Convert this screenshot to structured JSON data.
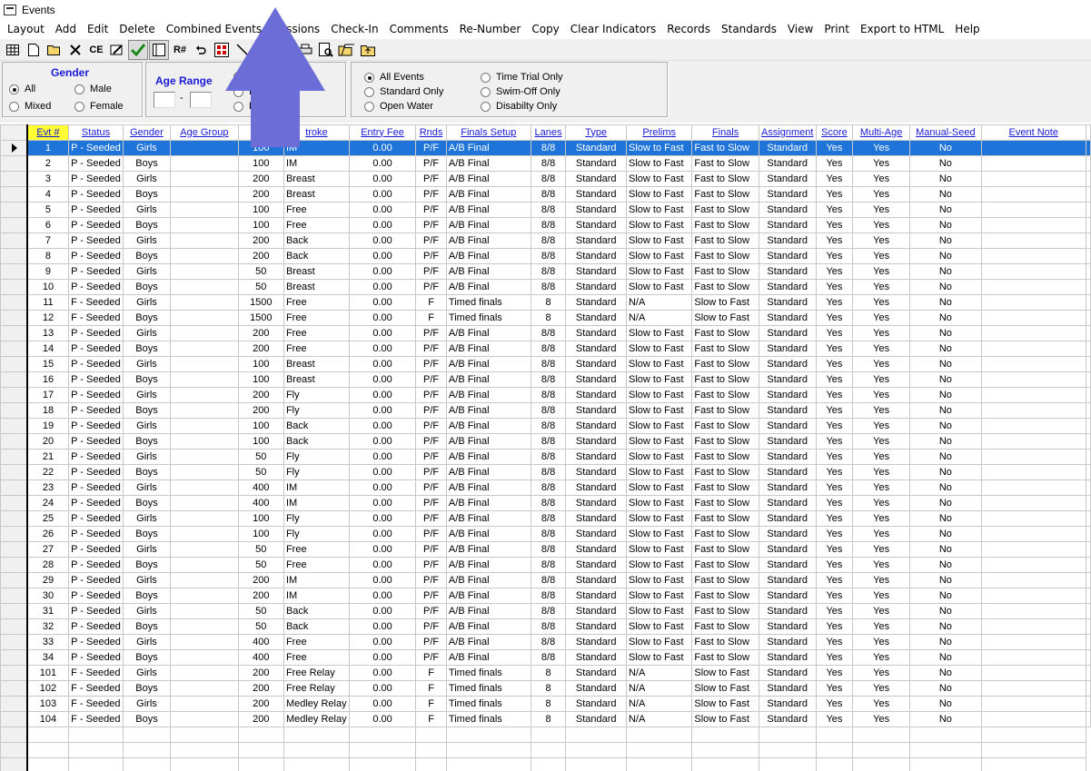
{
  "window": {
    "title": "Events"
  },
  "menu": [
    "Layout",
    "Add",
    "Edit",
    "Delete",
    "Combined Events",
    "Sessions",
    "Check-In",
    "Comments",
    "Re-Number",
    "Copy",
    "Clear Indicators",
    "Records",
    "Standards",
    "View",
    "Print",
    "Export to HTML",
    "Help"
  ],
  "toolbar": {
    "buttons": [
      {
        "name": "grid-icon"
      },
      {
        "name": "new-doc-icon"
      },
      {
        "name": "open-folder-icon"
      },
      {
        "name": "delete-x-icon"
      },
      {
        "name": "ce-icon",
        "text": "CE"
      },
      {
        "name": "edit-icon"
      },
      {
        "name": "checkmark-icon",
        "pressed": true
      },
      {
        "name": "panel-icon",
        "pressed": true
      },
      {
        "name": "renumber-icon",
        "text": "R#"
      },
      {
        "name": "undo-icon"
      },
      {
        "name": "calc-icon"
      },
      {
        "name": "arrows-icon"
      },
      {
        "name": "hidden-1-icon"
      },
      {
        "name": "hidden-2-icon"
      },
      {
        "name": "printer-icon"
      },
      {
        "name": "preview-icon"
      },
      {
        "name": "folder-open-icon"
      },
      {
        "name": "folder-up-icon"
      }
    ]
  },
  "filters": {
    "gender": {
      "title": "Gender",
      "options": [
        "All",
        "Male",
        "Mixed",
        "Female"
      ],
      "selected": "All"
    },
    "age_range": {
      "title": "Age Range",
      "separator": "-"
    },
    "round": {
      "options": [
        "I",
        "R",
        "y"
      ]
    },
    "event_type": {
      "options": [
        "All Events",
        "Standard Only",
        "Open Water",
        "Time Trial Only",
        "Swim-Off Only",
        "Disabilty Only"
      ],
      "selected": "All Events"
    }
  },
  "grid": {
    "columns": [
      "Evt #",
      "Status",
      "Gender",
      "Age Group",
      "Dist",
      "Stroke",
      "Entry Fee",
      "Rnds",
      "Finals Setup",
      "Lanes",
      "Type",
      "Prelims",
      "Finals",
      "Assignment",
      "Score",
      "Multi-Age",
      "Manual-Seed",
      "Event Note"
    ],
    "column_display": [
      "Evt #",
      "Status",
      "Gender",
      "Age Group",
      "Di",
      "troke",
      "Entry Fee",
      "Rnds",
      "Finals Setup",
      "Lanes",
      "Type",
      "Prelims",
      "Finals",
      "Assignment",
      "Score",
      "Multi-Age",
      "Manual-Seed",
      "Event Note"
    ],
    "selected_row": 0,
    "rows": [
      [
        "1",
        "P - Seeded",
        "Girls",
        "",
        "100",
        "IM",
        "0.00",
        "P/F",
        "A/B Final",
        "8/8",
        "Standard",
        "Slow to Fast",
        "Fast to Slow",
        "Standard",
        "Yes",
        "Yes",
        "No",
        ""
      ],
      [
        "2",
        "P - Seeded",
        "Boys",
        "",
        "100",
        "IM",
        "0.00",
        "P/F",
        "A/B Final",
        "8/8",
        "Standard",
        "Slow to Fast",
        "Fast to Slow",
        "Standard",
        "Yes",
        "Yes",
        "No",
        ""
      ],
      [
        "3",
        "P - Seeded",
        "Girls",
        "",
        "200",
        "Breast",
        "0.00",
        "P/F",
        "A/B Final",
        "8/8",
        "Standard",
        "Slow to Fast",
        "Fast to Slow",
        "Standard",
        "Yes",
        "Yes",
        "No",
        ""
      ],
      [
        "4",
        "P - Seeded",
        "Boys",
        "",
        "200",
        "Breast",
        "0.00",
        "P/F",
        "A/B Final",
        "8/8",
        "Standard",
        "Slow to Fast",
        "Fast to Slow",
        "Standard",
        "Yes",
        "Yes",
        "No",
        ""
      ],
      [
        "5",
        "P - Seeded",
        "Girls",
        "",
        "100",
        "Free",
        "0.00",
        "P/F",
        "A/B Final",
        "8/8",
        "Standard",
        "Slow to Fast",
        "Fast to Slow",
        "Standard",
        "Yes",
        "Yes",
        "No",
        ""
      ],
      [
        "6",
        "P - Seeded",
        "Boys",
        "",
        "100",
        "Free",
        "0.00",
        "P/F",
        "A/B Final",
        "8/8",
        "Standard",
        "Slow to Fast",
        "Fast to Slow",
        "Standard",
        "Yes",
        "Yes",
        "No",
        ""
      ],
      [
        "7",
        "P - Seeded",
        "Girls",
        "",
        "200",
        "Back",
        "0.00",
        "P/F",
        "A/B Final",
        "8/8",
        "Standard",
        "Slow to Fast",
        "Fast to Slow",
        "Standard",
        "Yes",
        "Yes",
        "No",
        ""
      ],
      [
        "8",
        "P - Seeded",
        "Boys",
        "",
        "200",
        "Back",
        "0.00",
        "P/F",
        "A/B Final",
        "8/8",
        "Standard",
        "Slow to Fast",
        "Fast to Slow",
        "Standard",
        "Yes",
        "Yes",
        "No",
        ""
      ],
      [
        "9",
        "P - Seeded",
        "Girls",
        "",
        "50",
        "Breast",
        "0.00",
        "P/F",
        "A/B Final",
        "8/8",
        "Standard",
        "Slow to Fast",
        "Fast to Slow",
        "Standard",
        "Yes",
        "Yes",
        "No",
        ""
      ],
      [
        "10",
        "P - Seeded",
        "Boys",
        "",
        "50",
        "Breast",
        "0.00",
        "P/F",
        "A/B Final",
        "8/8",
        "Standard",
        "Slow to Fast",
        "Fast to Slow",
        "Standard",
        "Yes",
        "Yes",
        "No",
        ""
      ],
      [
        "11",
        "F - Seeded",
        "Girls",
        "",
        "1500",
        "Free",
        "0.00",
        "F",
        "Timed finals",
        "8",
        "Standard",
        "N/A",
        "Slow to Fast",
        "Standard",
        "Yes",
        "Yes",
        "No",
        ""
      ],
      [
        "12",
        "F - Seeded",
        "Boys",
        "",
        "1500",
        "Free",
        "0.00",
        "F",
        "Timed finals",
        "8",
        "Standard",
        "N/A",
        "Slow to Fast",
        "Standard",
        "Yes",
        "Yes",
        "No",
        ""
      ],
      [
        "13",
        "P - Seeded",
        "Girls",
        "",
        "200",
        "Free",
        "0.00",
        "P/F",
        "A/B Final",
        "8/8",
        "Standard",
        "Slow to Fast",
        "Fast to Slow",
        "Standard",
        "Yes",
        "Yes",
        "No",
        ""
      ],
      [
        "14",
        "P - Seeded",
        "Boys",
        "",
        "200",
        "Free",
        "0.00",
        "P/F",
        "A/B Final",
        "8/8",
        "Standard",
        "Slow to Fast",
        "Fast to Slow",
        "Standard",
        "Yes",
        "Yes",
        "No",
        ""
      ],
      [
        "15",
        "P - Seeded",
        "Girls",
        "",
        "100",
        "Breast",
        "0.00",
        "P/F",
        "A/B Final",
        "8/8",
        "Standard",
        "Slow to Fast",
        "Fast to Slow",
        "Standard",
        "Yes",
        "Yes",
        "No",
        ""
      ],
      [
        "16",
        "P - Seeded",
        "Boys",
        "",
        "100",
        "Breast",
        "0.00",
        "P/F",
        "A/B Final",
        "8/8",
        "Standard",
        "Slow to Fast",
        "Fast to Slow",
        "Standard",
        "Yes",
        "Yes",
        "No",
        ""
      ],
      [
        "17",
        "P - Seeded",
        "Girls",
        "",
        "200",
        "Fly",
        "0.00",
        "P/F",
        "A/B Final",
        "8/8",
        "Standard",
        "Slow to Fast",
        "Fast to Slow",
        "Standard",
        "Yes",
        "Yes",
        "No",
        ""
      ],
      [
        "18",
        "P - Seeded",
        "Boys",
        "",
        "200",
        "Fly",
        "0.00",
        "P/F",
        "A/B Final",
        "8/8",
        "Standard",
        "Slow to Fast",
        "Fast to Slow",
        "Standard",
        "Yes",
        "Yes",
        "No",
        ""
      ],
      [
        "19",
        "P - Seeded",
        "Girls",
        "",
        "100",
        "Back",
        "0.00",
        "P/F",
        "A/B Final",
        "8/8",
        "Standard",
        "Slow to Fast",
        "Fast to Slow",
        "Standard",
        "Yes",
        "Yes",
        "No",
        ""
      ],
      [
        "20",
        "P - Seeded",
        "Boys",
        "",
        "100",
        "Back",
        "0.00",
        "P/F",
        "A/B Final",
        "8/8",
        "Standard",
        "Slow to Fast",
        "Fast to Slow",
        "Standard",
        "Yes",
        "Yes",
        "No",
        ""
      ],
      [
        "21",
        "P - Seeded",
        "Girls",
        "",
        "50",
        "Fly",
        "0.00",
        "P/F",
        "A/B Final",
        "8/8",
        "Standard",
        "Slow to Fast",
        "Fast to Slow",
        "Standard",
        "Yes",
        "Yes",
        "No",
        ""
      ],
      [
        "22",
        "P - Seeded",
        "Boys",
        "",
        "50",
        "Fly",
        "0.00",
        "P/F",
        "A/B Final",
        "8/8",
        "Standard",
        "Slow to Fast",
        "Fast to Slow",
        "Standard",
        "Yes",
        "Yes",
        "No",
        ""
      ],
      [
        "23",
        "P - Seeded",
        "Girls",
        "",
        "400",
        "IM",
        "0.00",
        "P/F",
        "A/B Final",
        "8/8",
        "Standard",
        "Slow to Fast",
        "Fast to Slow",
        "Standard",
        "Yes",
        "Yes",
        "No",
        ""
      ],
      [
        "24",
        "P - Seeded",
        "Boys",
        "",
        "400",
        "IM",
        "0.00",
        "P/F",
        "A/B Final",
        "8/8",
        "Standard",
        "Slow to Fast",
        "Fast to Slow",
        "Standard",
        "Yes",
        "Yes",
        "No",
        ""
      ],
      [
        "25",
        "P - Seeded",
        "Girls",
        "",
        "100",
        "Fly",
        "0.00",
        "P/F",
        "A/B Final",
        "8/8",
        "Standard",
        "Slow to Fast",
        "Fast to Slow",
        "Standard",
        "Yes",
        "Yes",
        "No",
        ""
      ],
      [
        "26",
        "P - Seeded",
        "Boys",
        "",
        "100",
        "Fly",
        "0.00",
        "P/F",
        "A/B Final",
        "8/8",
        "Standard",
        "Slow to Fast",
        "Fast to Slow",
        "Standard",
        "Yes",
        "Yes",
        "No",
        ""
      ],
      [
        "27",
        "P - Seeded",
        "Girls",
        "",
        "50",
        "Free",
        "0.00",
        "P/F",
        "A/B Final",
        "8/8",
        "Standard",
        "Slow to Fast",
        "Fast to Slow",
        "Standard",
        "Yes",
        "Yes",
        "No",
        ""
      ],
      [
        "28",
        "P - Seeded",
        "Boys",
        "",
        "50",
        "Free",
        "0.00",
        "P/F",
        "A/B Final",
        "8/8",
        "Standard",
        "Slow to Fast",
        "Fast to Slow",
        "Standard",
        "Yes",
        "Yes",
        "No",
        ""
      ],
      [
        "29",
        "P - Seeded",
        "Girls",
        "",
        "200",
        "IM",
        "0.00",
        "P/F",
        "A/B Final",
        "8/8",
        "Standard",
        "Slow to Fast",
        "Fast to Slow",
        "Standard",
        "Yes",
        "Yes",
        "No",
        ""
      ],
      [
        "30",
        "P - Seeded",
        "Boys",
        "",
        "200",
        "IM",
        "0.00",
        "P/F",
        "A/B Final",
        "8/8",
        "Standard",
        "Slow to Fast",
        "Fast to Slow",
        "Standard",
        "Yes",
        "Yes",
        "No",
        ""
      ],
      [
        "31",
        "P - Seeded",
        "Girls",
        "",
        "50",
        "Back",
        "0.00",
        "P/F",
        "A/B Final",
        "8/8",
        "Standard",
        "Slow to Fast",
        "Fast to Slow",
        "Standard",
        "Yes",
        "Yes",
        "No",
        ""
      ],
      [
        "32",
        "P - Seeded",
        "Boys",
        "",
        "50",
        "Back",
        "0.00",
        "P/F",
        "A/B Final",
        "8/8",
        "Standard",
        "Slow to Fast",
        "Fast to Slow",
        "Standard",
        "Yes",
        "Yes",
        "No",
        ""
      ],
      [
        "33",
        "P - Seeded",
        "Girls",
        "",
        "400",
        "Free",
        "0.00",
        "P/F",
        "A/B Final",
        "8/8",
        "Standard",
        "Slow to Fast",
        "Fast to Slow",
        "Standard",
        "Yes",
        "Yes",
        "No",
        ""
      ],
      [
        "34",
        "P - Seeded",
        "Boys",
        "",
        "400",
        "Free",
        "0.00",
        "P/F",
        "A/B Final",
        "8/8",
        "Standard",
        "Slow to Fast",
        "Fast to Slow",
        "Standard",
        "Yes",
        "Yes",
        "No",
        ""
      ],
      [
        "101",
        "F - Seeded",
        "Girls",
        "",
        "200",
        "Free Relay",
        "0.00",
        "F",
        "Timed finals",
        "8",
        "Standard",
        "N/A",
        "Slow to Fast",
        "Standard",
        "Yes",
        "Yes",
        "No",
        ""
      ],
      [
        "102",
        "F - Seeded",
        "Boys",
        "",
        "200",
        "Free Relay",
        "0.00",
        "F",
        "Timed finals",
        "8",
        "Standard",
        "N/A",
        "Slow to Fast",
        "Standard",
        "Yes",
        "Yes",
        "No",
        ""
      ],
      [
        "103",
        "F - Seeded",
        "Girls",
        "",
        "200",
        "Medley Relay",
        "0.00",
        "F",
        "Timed finals",
        "8",
        "Standard",
        "N/A",
        "Slow to Fast",
        "Standard",
        "Yes",
        "Yes",
        "No",
        ""
      ],
      [
        "104",
        "F - Seeded",
        "Boys",
        "",
        "200",
        "Medley Relay",
        "0.00",
        "F",
        "Timed finals",
        "8",
        "Standard",
        "N/A",
        "Slow to Fast",
        "Standard",
        "Yes",
        "Yes",
        "No",
        ""
      ]
    ],
    "empty_rows": 3
  },
  "colors": {
    "accent_text": "#1a1ad6",
    "selected_row": "#1e74d8",
    "selected_header": "#ffff33",
    "overlay_arrow": "#6d6dd8"
  }
}
